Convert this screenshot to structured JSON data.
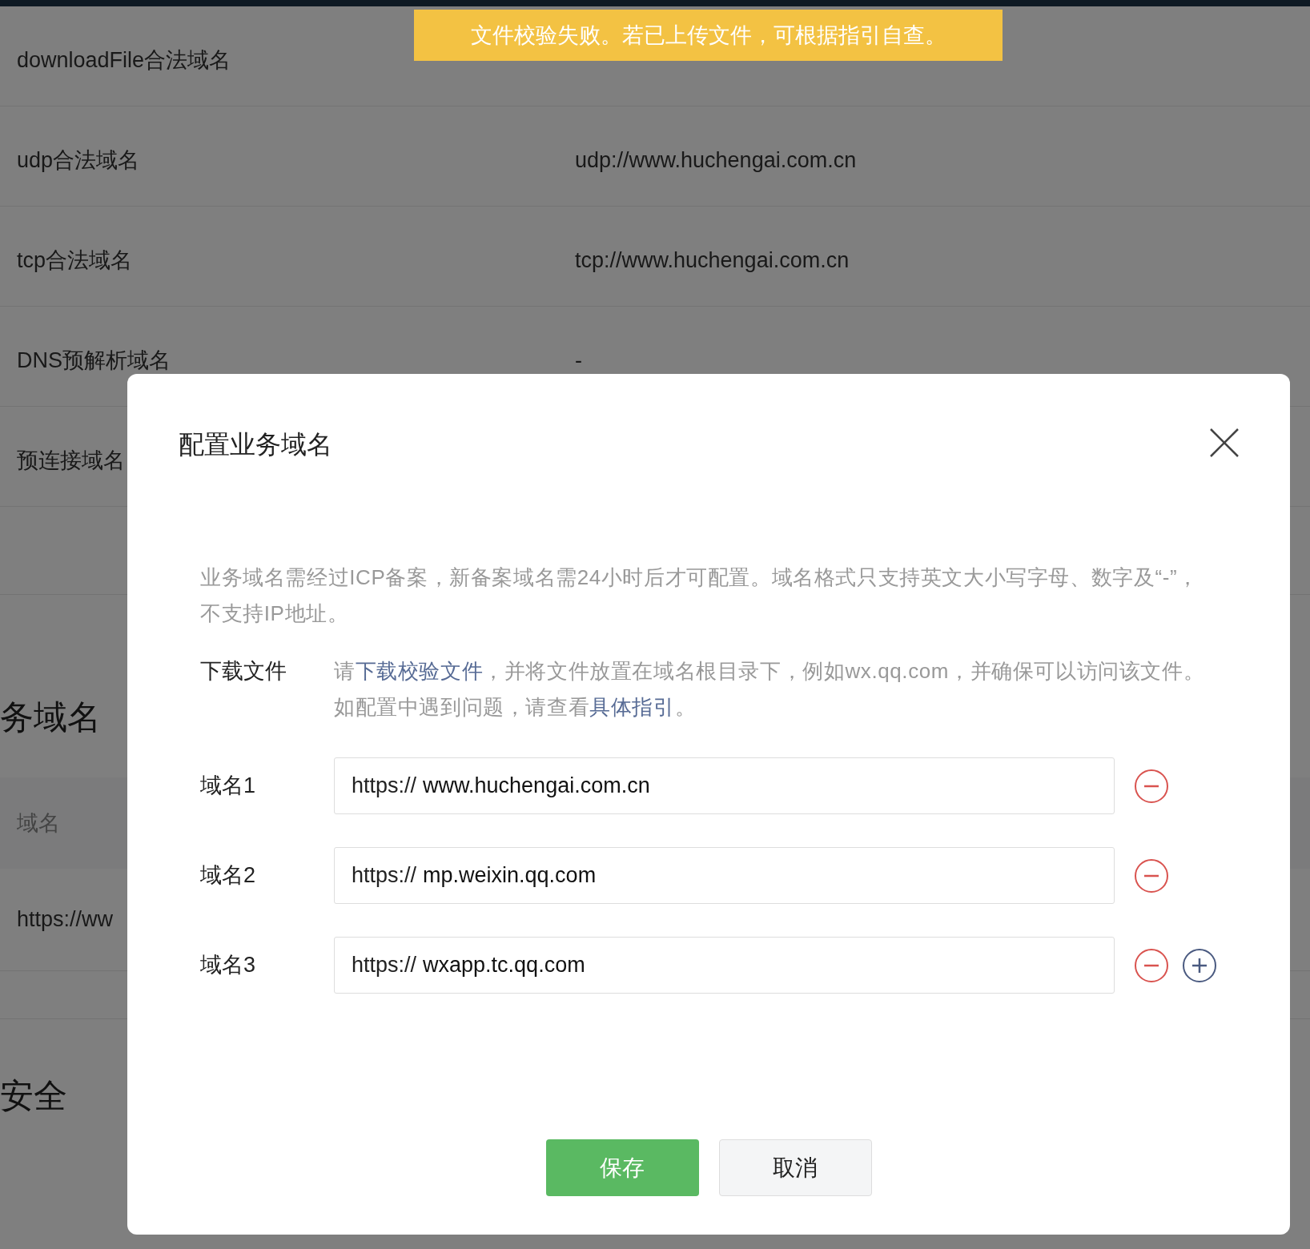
{
  "toast": {
    "text": "文件校验失败。若已上传文件，可根据指引自查。"
  },
  "background": {
    "rows": [
      {
        "label": "downloadFile合法域名"
      },
      {
        "label": "udp合法域名",
        "value": "udp://www.huchengai.com.cn"
      },
      {
        "label": "tcp合法域名",
        "value": "tcp://www.huchengai.com.cn"
      },
      {
        "label": "DNS预解析域名",
        "value": "-"
      },
      {
        "label": "预连接域名"
      }
    ],
    "section_title": "务域名",
    "table_header": "域名",
    "table_row": "https://ww",
    "security_title": "安全"
  },
  "dialog": {
    "title": "配置业务域名",
    "notice": "业务域名需经过ICP备案，新备案域名需24小时后才可配置。域名格式只支持英文大小写字母、数字及“-”，不支持IP地址。",
    "download": {
      "label": "下载文件",
      "parts": [
        {
          "kind": "text",
          "text": "请"
        },
        {
          "kind": "link",
          "text": "下载校验文件"
        },
        {
          "kind": "text",
          "text": "，并将文件放置在域名根目录下，例如wx.qq.com，并确保可以访问该文件。如配置中遇到问题，请查看"
        },
        {
          "kind": "link",
          "text": "具体指引"
        },
        {
          "kind": "text",
          "text": "。"
        }
      ]
    },
    "domains": [
      {
        "label": "域名1",
        "prefix": "https://",
        "value": "www.huchengai.com.cn",
        "can_add": false
      },
      {
        "label": "域名2",
        "prefix": "https://",
        "value": "mp.weixin.qq.com",
        "can_add": false
      },
      {
        "label": "域名3",
        "prefix": "https://",
        "value": "wxapp.tc.qq.com",
        "can_add": true
      }
    ],
    "buttons": [
      {
        "kind": "primary",
        "label": "保存"
      },
      {
        "kind": "default",
        "label": "取消"
      }
    ]
  }
}
